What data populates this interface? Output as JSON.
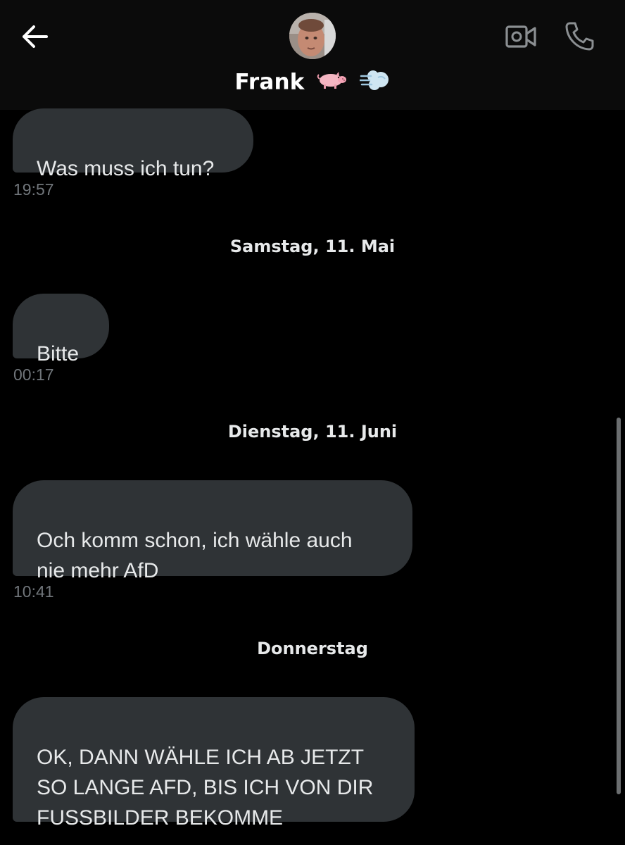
{
  "header": {
    "contact_name": "Frank",
    "name_emojis": "🐖💨",
    "back_icon": "arrow-left-icon",
    "video_icon": "video-camera-icon",
    "phone_icon": "phone-icon"
  },
  "messages": [
    {
      "text": "Was muss ich tun?",
      "time": "19:57"
    },
    {
      "date": "Samstag, 11. Mai"
    },
    {
      "text": "Bitte",
      "time": "00:17"
    },
    {
      "date": "Dienstag, 11. Juni"
    },
    {
      "text": "Och komm schon, ich wähle auch\nnie mehr AfD",
      "time": "10:41"
    },
    {
      "date": "Donnerstag"
    },
    {
      "text": "OK, DANN WÄHLE ICH AB JETZT\nSO LANGE AFD, BIS ICH VON DIR\nFUSSBILDER BEKOMME"
    }
  ],
  "colors": {
    "background": "#000000",
    "bubble": "#2f3336",
    "text": "#e7e9ea",
    "muted": "#71767b"
  }
}
